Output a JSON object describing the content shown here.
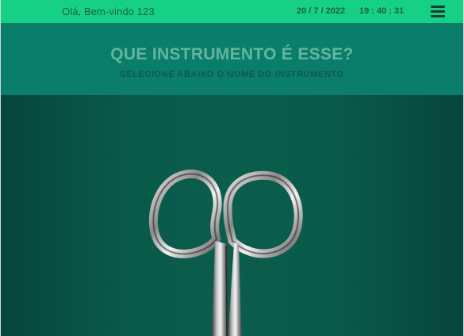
{
  "topbar": {
    "greeting": "Olá, Bem-vindo 123",
    "date": "20 / 7 / 2022",
    "time": "19 : 40 : 31",
    "menu_icon": "hamburger-menu-icon"
  },
  "header": {
    "title": "QUE INSTRUMENTO É ESSE?",
    "subtitle": "SELECIONE ABAIXO O NOME DO INSTRUMENTO"
  },
  "instrument_image": {
    "icon": "scissors-icon"
  },
  "colors": {
    "topbar_bg": "#16d185",
    "header_bg": "#0a7e6a",
    "stage_bg": "#0b5d4c",
    "title_text": "#63b59e",
    "subtitle_text": "#0e5a4a"
  }
}
